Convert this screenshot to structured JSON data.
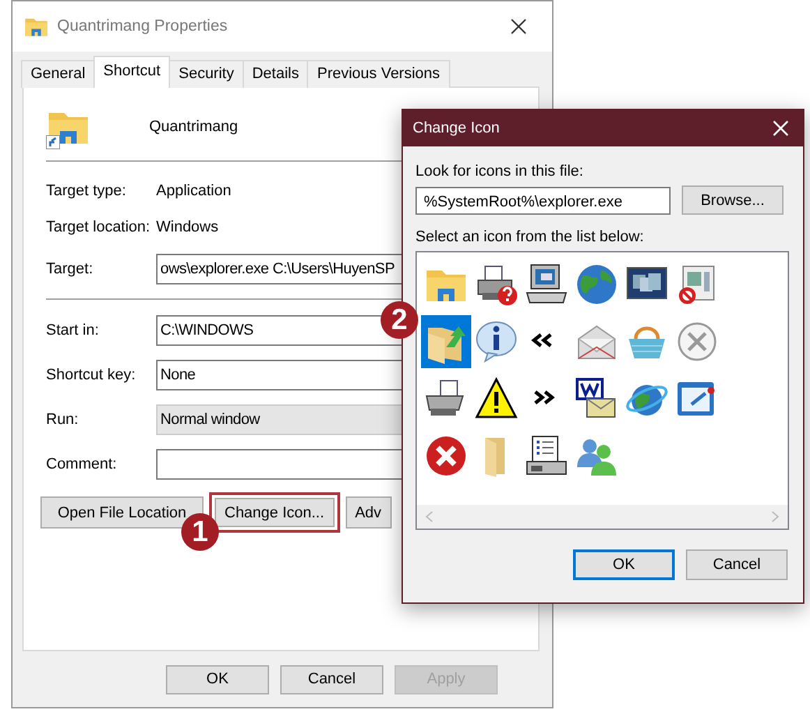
{
  "properties_window": {
    "title": "Quantrimang Properties",
    "tabs": [
      {
        "label": "General",
        "selected": false
      },
      {
        "label": "Shortcut",
        "selected": true
      },
      {
        "label": "Security",
        "selected": false
      },
      {
        "label": "Details",
        "selected": false
      },
      {
        "label": "Previous Versions",
        "selected": false
      }
    ],
    "shortcut_name": "Quantrimang",
    "info": [
      {
        "label": "Target type:",
        "value": "Application",
        "kind": "text"
      },
      {
        "label": "Target location:",
        "value": "Windows",
        "kind": "text"
      },
      {
        "label": "Target:",
        "value": "ows\\explorer.exe C:\\Users\\HuyenSP",
        "kind": "field"
      }
    ],
    "fields": [
      {
        "label": "Start in:",
        "value": "C:\\WINDOWS",
        "kind": "text"
      },
      {
        "label": "Shortcut key:",
        "value": "None",
        "kind": "text"
      },
      {
        "label": "Run:",
        "value": "Normal window",
        "kind": "dropdown"
      },
      {
        "label": "Comment:",
        "kind": "text"
      }
    ],
    "buttons": [
      {
        "label": "Open File Location",
        "highlighted": false
      },
      {
        "label": "Change Icon...",
        "highlighted": true
      },
      {
        "label": "Adv",
        "highlighted": false
      }
    ],
    "footer_buttons": [
      {
        "label": "OK",
        "disabled": false
      },
      {
        "label": "Cancel",
        "disabled": false
      },
      {
        "label": "Apply",
        "disabled": true
      }
    ]
  },
  "change_icon_dialog": {
    "title": "Change Icon",
    "file_label": "Look for icons in this file:",
    "file_value": "%SystemRoot%\\explorer.exe",
    "browse_button": "Browse...",
    "list_label": "Select an icon from the list below:",
    "icons": [
      {
        "selected": false
      },
      {
        "selected": false
      },
      {
        "selected": false
      },
      {
        "selected": false
      },
      {
        "selected": false
      },
      {
        "selected": false
      },
      {
        "selected": true
      },
      {
        "selected": false
      },
      {
        "selected": false
      },
      {
        "selected": false
      },
      {
        "selected": false
      },
      {
        "selected": false
      },
      {
        "selected": false
      },
      {
        "selected": false
      },
      {
        "selected": false
      },
      {
        "selected": false
      },
      {
        "selected": false
      },
      {
        "selected": false
      },
      {
        "selected": false
      },
      {
        "selected": false
      },
      {
        "selected": false
      },
      {
        "selected": false
      }
    ],
    "buttons": [
      {
        "label": "OK",
        "default": true
      },
      {
        "label": "Cancel",
        "default": false
      }
    ]
  },
  "step_markers": [
    {
      "label": "1"
    },
    {
      "label": "2"
    }
  ]
}
